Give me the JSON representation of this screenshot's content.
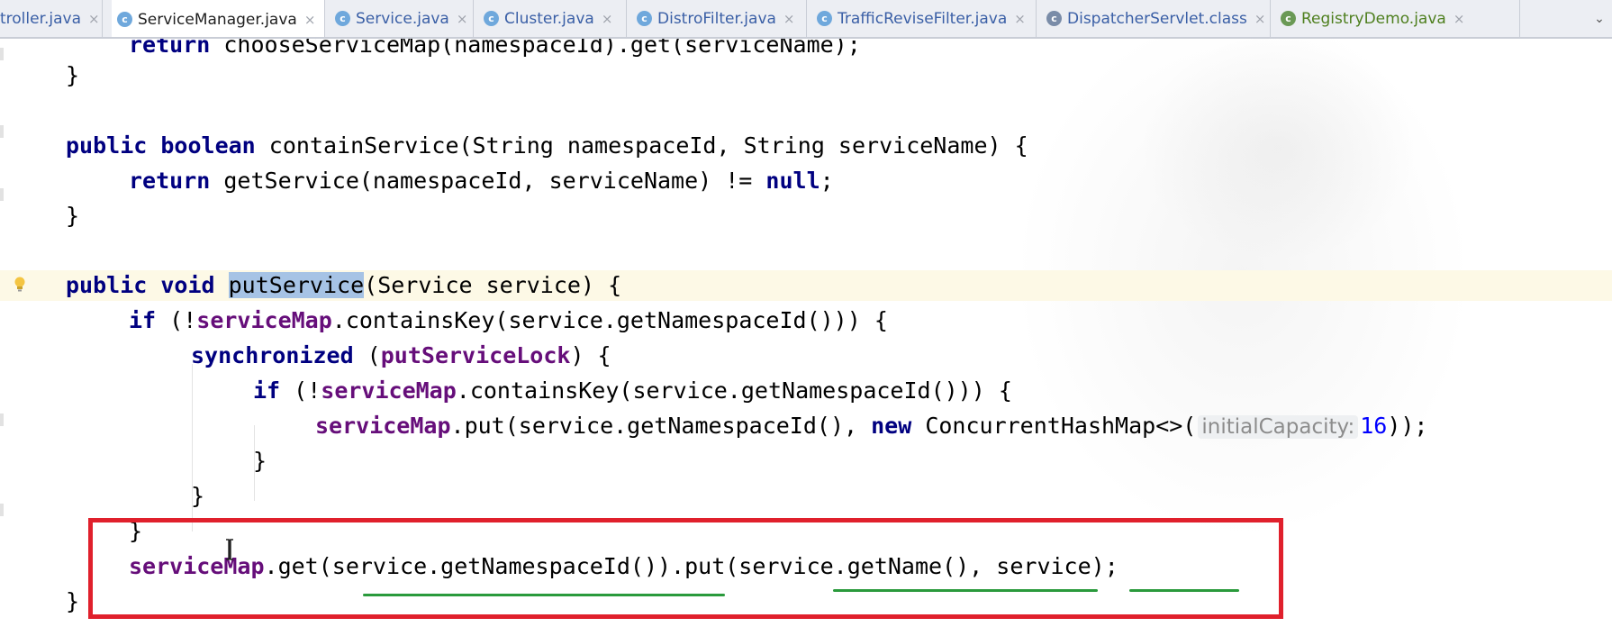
{
  "tabs": [
    {
      "label": "troller.java",
      "icon": "class-icon",
      "active": false
    },
    {
      "label": "ServiceManager.java",
      "icon": "class-icon",
      "active": true
    },
    {
      "label": "Service.java",
      "icon": "class-icon",
      "active": false
    },
    {
      "label": "Cluster.java",
      "icon": "class-icon",
      "active": false
    },
    {
      "label": "DistroFilter.java",
      "icon": "class-icon",
      "active": false
    },
    {
      "label": "TrafficReviseFilter.java",
      "icon": "class-icon",
      "active": false
    },
    {
      "label": "DispatcherServlet.class",
      "icon": "compiled-class-icon",
      "active": false
    },
    {
      "label": "RegistryDemo.java",
      "icon": "runnable-class-icon",
      "active": false
    }
  ],
  "tab_close_glyph": "×",
  "tab_menu_glyph": "⌄",
  "code": {
    "line0": [
      "return ",
      "chooseServiceMap(namespaceId).get(serviceName);"
    ],
    "line1": "}",
    "line3": [
      "public ",
      "boolean ",
      "containService(String namespaceId, String serviceName) {"
    ],
    "line4": [
      "return ",
      "getService(namespaceId, serviceName) != ",
      "null",
      ";"
    ],
    "line5": "}",
    "line7": [
      "public ",
      "void ",
      "putService",
      "(Service service) {"
    ],
    "line8": [
      "if ",
      "(!",
      "serviceMap",
      ".containsKey(service.getNamespaceId())) {"
    ],
    "line9": [
      "synchronized ",
      "(",
      "putServiceLock",
      ") {"
    ],
    "line10": [
      "if ",
      "(!",
      "serviceMap",
      ".containsKey(service.getNamespaceId())) {"
    ],
    "line11": [
      "serviceMap",
      ".put(service.getNamespaceId(), ",
      "new ",
      "ConcurrentHashMap<>(",
      "initialCapacity:",
      " ",
      "16",
      "));"
    ],
    "line12": "}",
    "line13": "}",
    "line14": "}",
    "line15": [
      "serviceMap",
      ".get(service.getNamespaceId()).put(service.getName(), service);"
    ],
    "line16": "}"
  },
  "colors": {
    "keyword": "#000080",
    "field": "#660e7a",
    "number": "#0000ff",
    "annotation_box": "#e0202c",
    "annotation_underline": "#2a9a3c",
    "selection": "#a6c3e5"
  }
}
